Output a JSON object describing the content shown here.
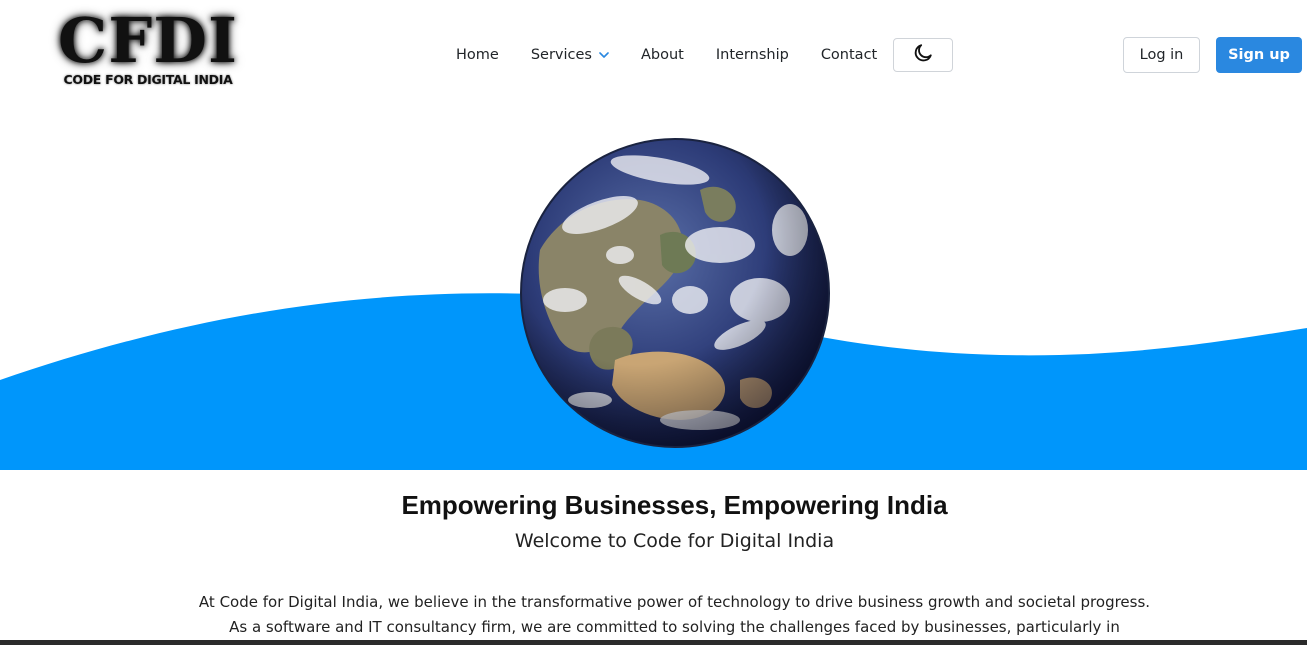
{
  "brand": {
    "logo_main": "CFDI",
    "logo_sub": "CODE FOR DIGITAL INDIA"
  },
  "nav": {
    "items": [
      {
        "label": "Home"
      },
      {
        "label": "Services"
      },
      {
        "label": "About"
      },
      {
        "label": "Internship"
      },
      {
        "label": "Contact"
      }
    ],
    "theme_toggle_icon": "moon-icon",
    "services_dropdown_icon": "chevron-down-icon"
  },
  "auth": {
    "login_label": "Log in",
    "signup_label": "Sign up"
  },
  "hero": {
    "image": "earth-globe",
    "wave_color": "#0096fb"
  },
  "content": {
    "headline": "Empowering Businesses, Empowering India",
    "subheadline": "Welcome to Code for Digital India",
    "paragraph_line1": "At Code for Digital India, we believe in the transformative power of technology to drive business growth and societal progress.",
    "paragraph_line2": "As a software and IT consultancy firm, we are committed to solving the challenges faced by businesses, particularly in"
  },
  "colors": {
    "accent": "#2a88e0",
    "wave": "#0096fb"
  }
}
